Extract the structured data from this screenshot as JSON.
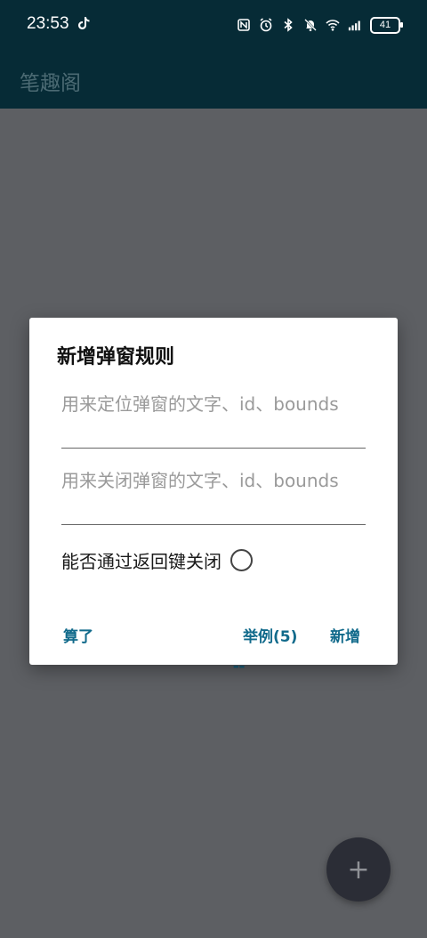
{
  "status_bar": {
    "time": "23:53",
    "battery": "41",
    "icons": [
      "tiktok-icon",
      "nfc-icon",
      "alarm-icon",
      "bluetooth-icon",
      "mute-icon",
      "wifi-icon",
      "signal-icon",
      "battery-icon"
    ]
  },
  "app_bar": {
    "title": "笔趣阁"
  },
  "dialog": {
    "title": "新增弹窗规则",
    "locate_placeholder": "用来定位弹窗的文字、id、bounds",
    "close_placeholder": "用来关闭弹窗的文字、id、bounds",
    "back_key_label": "能否通过返回键关闭",
    "cancel_label": "算了",
    "example_label": "举例(5)",
    "add_label": "新增"
  },
  "fab": {
    "icon": "plus-icon",
    "symbol": "+"
  },
  "colors": {
    "appbar_bg": "#062b36",
    "scrim": "#5d5f63",
    "accent": "#116a8b",
    "fab_bg": "#2b2d36"
  }
}
